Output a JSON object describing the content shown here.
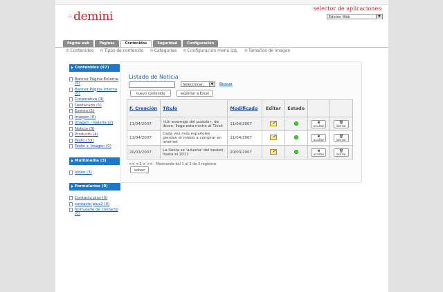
{
  "header": {
    "logo_text": "demini",
    "logo_dots": "⁘",
    "app_selector_label": "selector de aplicaciones:",
    "app_selector_value": "Edición Web"
  },
  "tabs": [
    {
      "label": "Página web",
      "active": false
    },
    {
      "label": "Páginas",
      "active": false
    },
    {
      "label": "Contenidos",
      "active": true
    },
    {
      "label": "Seguridad",
      "active": false
    },
    {
      "label": "Configuración",
      "active": false
    }
  ],
  "subnav": [
    "Contenidos",
    "Tipos de contenido",
    "Categorías",
    "Configuración menú izq.",
    "Tamaños de imagen"
  ],
  "sidebar": {
    "sections": [
      {
        "title": "Contenidos (47)",
        "items": [
          "Banner Página Externa (0)",
          "Banner Página Interna (0)",
          "Corporativa (3)",
          "Destacado (1)",
          "Evento (1)",
          "Imagen (0)",
          "Imagen - Galería (2)",
          "Noticia (3)",
          "Producto (4)",
          "Texto (33)",
          "Texto + Imagen (0)"
        ]
      },
      {
        "title": "Multimedia (3)",
        "items": [
          "Video (3)"
        ]
      },
      {
        "title": "Formularios (0)",
        "items": [
          "Contacto plus (0)",
          "contacto plus2 (0)",
          "formulario de contacto (0)"
        ]
      }
    ]
  },
  "main": {
    "title": "Listado de Noticia",
    "search_value": "",
    "filter_select": "Seleccionar..",
    "search_link": "Buscar",
    "new_button": "nuevo contenido",
    "export_button": "exportar a Excel",
    "columns": [
      "F. Creación",
      "Título",
      "Modificado",
      "Editar",
      "Estado",
      "",
      ""
    ],
    "rows": [
      {
        "created": "11/04/2007",
        "title": "«Un enemigo del pueblo», de Ibsen, llega esta noche al Tívoli",
        "modified": "11/04/2007"
      },
      {
        "created": "11/04/2007",
        "title": "Cada vez más españoles pierden el miedo a comprar en Internet",
        "modified": "11/04/2007"
      },
      {
        "created": "20/03/2007",
        "title": "La Sexta se 'adueña' del basket hasta el 2011",
        "modified": "20/03/2007"
      }
    ],
    "hide_label": "ocultar",
    "delete_label": "borrar",
    "pager_nav": "<< <  1  > >>",
    "pager_text": "Mostrando del 1 al 3 de 3 registros",
    "back_button": "volver"
  },
  "colors": {
    "accent": "#1e78c9",
    "brand": "#c52a2a",
    "status_active": "#33dd22"
  }
}
